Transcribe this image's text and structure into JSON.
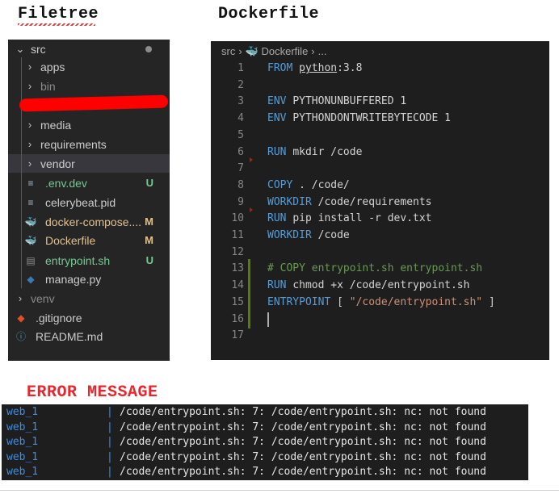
{
  "headings": {
    "filetree": "Filetree",
    "dockerfile": "Dockerfile",
    "error": "ERROR MESSAGE"
  },
  "filetree": {
    "items": [
      {
        "label": "src",
        "kind": "folder-open",
        "indent": 0,
        "badge": "",
        "color": "#cccccc"
      },
      {
        "label": "apps",
        "kind": "folder",
        "indent": 1,
        "badge": "",
        "color": "#cccccc"
      },
      {
        "label": "bin",
        "kind": "folder",
        "indent": 1,
        "badge": "",
        "color": "#8a8a8a"
      },
      {
        "label": "media",
        "kind": "folder",
        "indent": 1,
        "badge": "",
        "color": "#cccccc"
      },
      {
        "label": "requirements",
        "kind": "folder",
        "indent": 1,
        "badge": "",
        "color": "#cccccc"
      },
      {
        "label": "vendor",
        "kind": "folder",
        "indent": 1,
        "badge": "",
        "color": "#cccccc"
      },
      {
        "label": ".env.dev",
        "kind": "file",
        "indent": 1,
        "badge": "U",
        "color": "#73c991"
      },
      {
        "label": "celerybeat.pid",
        "kind": "file",
        "indent": 1,
        "badge": "",
        "color": "#cccccc"
      },
      {
        "label": "docker-compose....",
        "kind": "docker-compose",
        "indent": 1,
        "badge": "M",
        "color": "#e2c08d"
      },
      {
        "label": "Dockerfile",
        "kind": "docker",
        "indent": 1,
        "badge": "M",
        "color": "#e2c08d"
      },
      {
        "label": "entrypoint.sh",
        "kind": "shell",
        "indent": 1,
        "badge": "U",
        "color": "#73c991"
      },
      {
        "label": "manage.py",
        "kind": "python",
        "indent": 1,
        "badge": "",
        "color": "#cccccc"
      },
      {
        "label": "venv",
        "kind": "folder",
        "indent": 0,
        "badge": "",
        "color": "#8a8a8a"
      },
      {
        "label": ".gitignore",
        "kind": "git",
        "indent": 0,
        "badge": "",
        "color": "#cccccc"
      },
      {
        "label": "README.md",
        "kind": "info",
        "indent": 0,
        "badge": "",
        "color": "#cccccc"
      }
    ],
    "selected_index": 5
  },
  "editor": {
    "breadcrumb": {
      "folder": "src",
      "file": "Dockerfile",
      "more": "..."
    },
    "lines": [
      {
        "n": "1",
        "parts": [
          {
            "t": "FROM ",
            "c": "kw"
          },
          {
            "t": "python",
            "c": "ul"
          },
          {
            "t": ":3.8",
            "c": ""
          }
        ]
      },
      {
        "n": "2",
        "parts": []
      },
      {
        "n": "3",
        "parts": [
          {
            "t": "ENV ",
            "c": "kw"
          },
          {
            "t": "PYTHONUNBUFFERED 1",
            "c": ""
          }
        ]
      },
      {
        "n": "4",
        "parts": [
          {
            "t": "ENV ",
            "c": "kw"
          },
          {
            "t": "PYTHONDONTWRITEBYTECODE 1",
            "c": ""
          }
        ]
      },
      {
        "n": "5",
        "parts": []
      },
      {
        "n": "6",
        "parts": [
          {
            "t": "RUN ",
            "c": "kw"
          },
          {
            "t": "mkdir /code",
            "c": ""
          }
        ]
      },
      {
        "n": "7",
        "parts": []
      },
      {
        "n": "8",
        "parts": [
          {
            "t": "COPY ",
            "c": "kw"
          },
          {
            "t": ". /code/",
            "c": ""
          }
        ]
      },
      {
        "n": "9",
        "parts": [
          {
            "t": "WORKDIR ",
            "c": "kw"
          },
          {
            "t": "/code/requirements",
            "c": ""
          }
        ]
      },
      {
        "n": "10",
        "parts": [
          {
            "t": "RUN ",
            "c": "kw"
          },
          {
            "t": "pip install -r dev.txt",
            "c": ""
          }
        ]
      },
      {
        "n": "11",
        "parts": [
          {
            "t": "WORKDIR ",
            "c": "kw"
          },
          {
            "t": "/code",
            "c": ""
          }
        ]
      },
      {
        "n": "12",
        "parts": []
      },
      {
        "n": "13",
        "parts": [
          {
            "t": "# COPY entrypoint.sh entrypoint.sh",
            "c": "cm"
          }
        ]
      },
      {
        "n": "14",
        "parts": [
          {
            "t": "RUN ",
            "c": "kw"
          },
          {
            "t": "chmod +x /code/entrypoint.sh",
            "c": ""
          }
        ]
      },
      {
        "n": "15",
        "parts": [
          {
            "t": "ENTRYPOINT ",
            "c": "kw"
          },
          {
            "t": "[ ",
            "c": ""
          },
          {
            "t": "\"/code/entrypoint.sh\"",
            "c": "st"
          },
          {
            "t": " ]",
            "c": ""
          }
        ]
      },
      {
        "n": "16",
        "parts": []
      },
      {
        "n": "17",
        "parts": []
      }
    ]
  },
  "terminal": {
    "lines": [
      {
        "name": "web_1",
        "sep": "|",
        "msg": "/code/entrypoint.sh: 7: /code/entrypoint.sh: nc: not found"
      },
      {
        "name": "web_1",
        "sep": "|",
        "msg": "/code/entrypoint.sh: 7: /code/entrypoint.sh: nc: not found"
      },
      {
        "name": "web_1",
        "sep": "|",
        "msg": "/code/entrypoint.sh: 7: /code/entrypoint.sh: nc: not found"
      },
      {
        "name": "web_1",
        "sep": "|",
        "msg": "/code/entrypoint.sh: 7: /code/entrypoint.sh: nc: not found"
      },
      {
        "name": "web_1",
        "sep": "|",
        "msg": "/code/entrypoint.sh: 7: /code/entrypoint.sh: nc: not found"
      }
    ]
  },
  "colors": {
    "added": "#73c991",
    "modified": "#e2c08d",
    "keyword": "#569cd6",
    "comment": "#6a9955",
    "string": "#ce9178",
    "error_heading": "#e8262b"
  }
}
